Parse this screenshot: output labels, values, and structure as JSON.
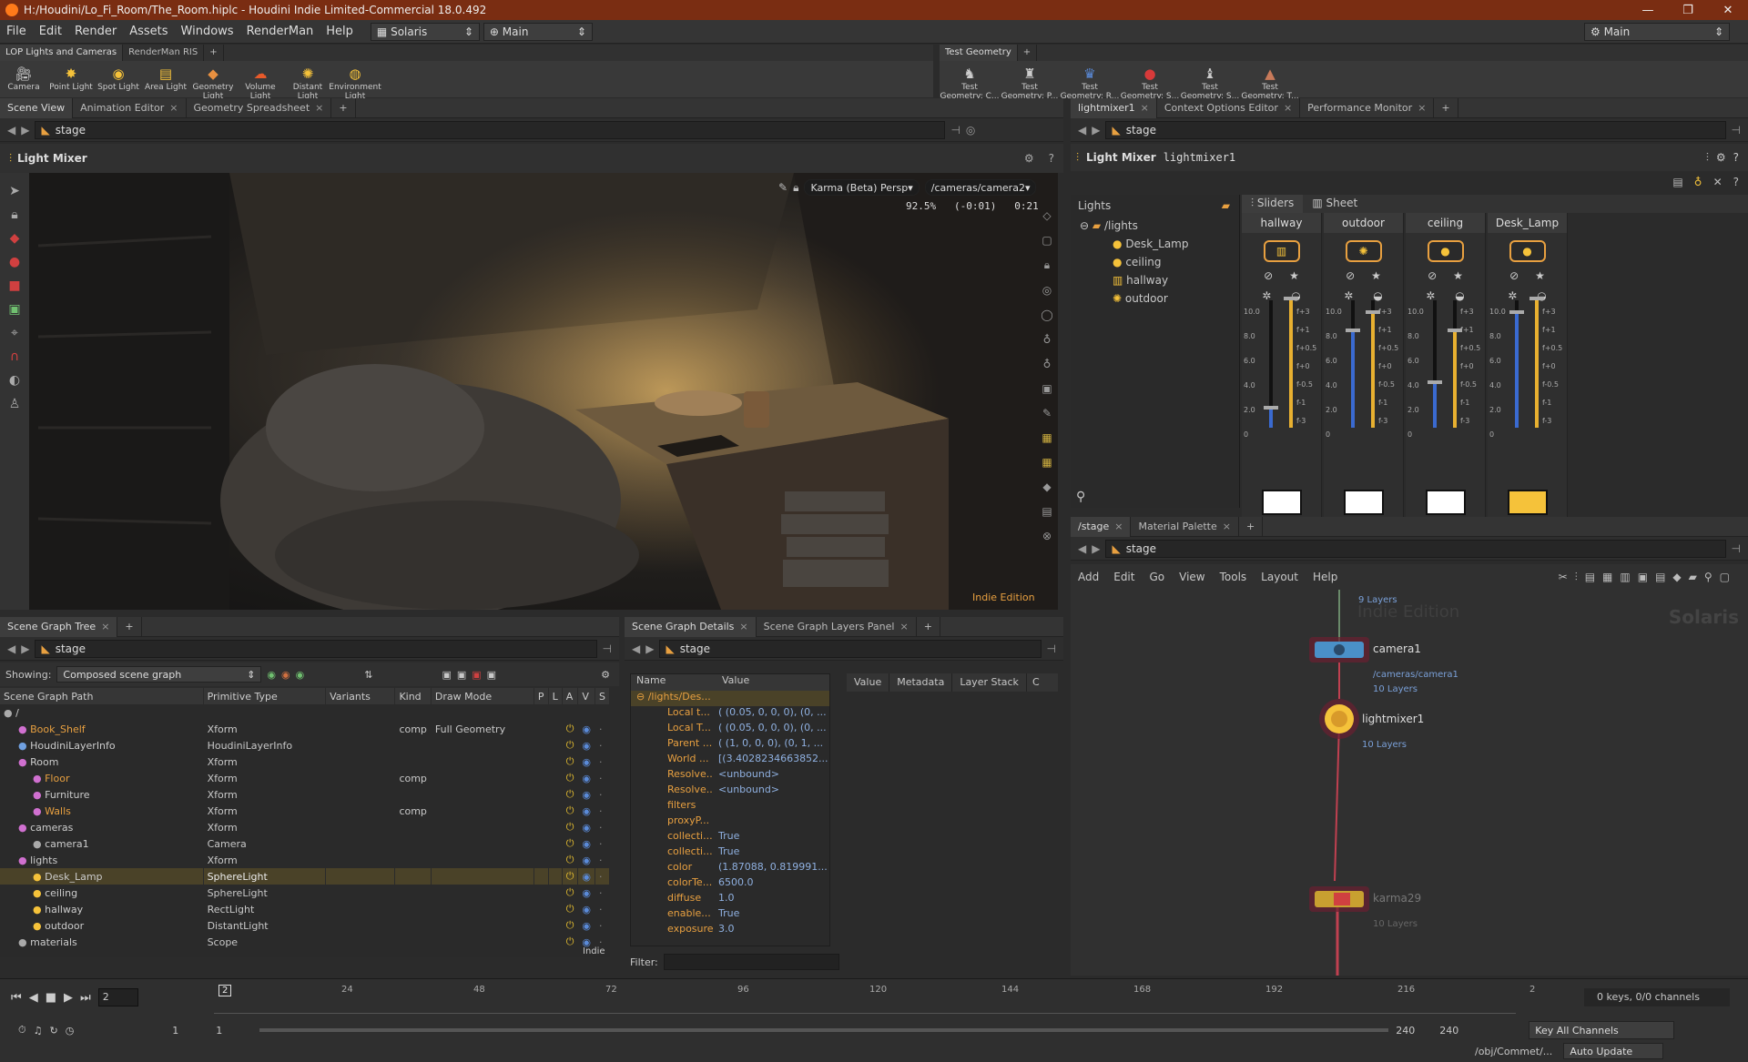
{
  "window": {
    "title": "H:/Houdini/Lo_Fi_Room/The_Room.hiplc - Houdini Indie Limited-Commercial 18.0.492",
    "controls": [
      "—",
      "❐",
      "✕"
    ]
  },
  "menu": {
    "items": [
      "File",
      "Edit",
      "Render",
      "Assets",
      "Windows",
      "RenderMan",
      "Help"
    ],
    "desktop": "Solaris",
    "context": "Main",
    "right_desktop": "Main"
  },
  "shelf_left": {
    "tabs": [
      "LOP Lights and Cameras",
      "RenderMan RIS"
    ],
    "tools": [
      {
        "label": "Camera",
        "icon": "camera-icon"
      },
      {
        "label": "Point Light",
        "icon": "point-light-icon"
      },
      {
        "label": "Spot Light",
        "icon": "spot-light-icon"
      },
      {
        "label": "Area Light",
        "icon": "area-light-icon"
      },
      {
        "label": "Geometry Light",
        "icon": "geometry-light-icon"
      },
      {
        "label": "Volume Light",
        "icon": "volume-light-icon"
      },
      {
        "label": "Distant Light",
        "icon": "distant-light-icon"
      },
      {
        "label": "Environment Light",
        "icon": "environment-light-icon"
      }
    ]
  },
  "shelf_right": {
    "tabs": [
      "Test Geometry"
    ],
    "tools": [
      "Test Geometry: C...",
      "Test Geometry: P...",
      "Test Geometry: R...",
      "Test Geometry: S...",
      "Test Geometry: S...",
      "Test Geometry: T..."
    ]
  },
  "scene_view": {
    "tabs": [
      "Scene View",
      "Animation Editor",
      "Geometry Spreadsheet"
    ],
    "path": "stage",
    "title": "Light Mixer",
    "renderer": "Karma (Beta)",
    "persp": "Persp",
    "camera": "/cameras/camera2",
    "stats": "92.5%   (-0:01)   0:21",
    "watermark": "Indie Edition"
  },
  "light_mixer": {
    "tabs": [
      "lightmixer1",
      "Context Options Editor",
      "Performance Monitor"
    ],
    "path": "stage",
    "title": "Light Mixer",
    "node": "lightmixer1",
    "lights_header": "Lights",
    "tree_root": "/lights",
    "tree": [
      "Desk_Lamp",
      "ceiling",
      "hallway",
      "outdoor"
    ],
    "view_tabs": [
      "Sliders",
      "Sheet"
    ],
    "strips": [
      {
        "name": "hallway",
        "swatch": "#ffffff"
      },
      {
        "name": "outdoor",
        "swatch": "#ffffff"
      },
      {
        "name": "ceiling",
        "swatch": "#ffffff"
      },
      {
        "name": "Desk_Lamp",
        "swatch": "#f5c23a"
      }
    ],
    "scale_left": [
      "10.0",
      "8.0",
      "6.0",
      "4.0",
      "2.0",
      "0"
    ],
    "scale_right": [
      "f+3",
      "f+1",
      "f+0.5",
      "f+0",
      "f-0.5",
      "f-1",
      "f-3"
    ]
  },
  "scene_graph": {
    "tabs": [
      "Scene Graph Tree"
    ],
    "path": "stage",
    "showing_label": "Showing:",
    "showing": "Composed scene graph",
    "columns": [
      "Scene Graph Path",
      "Primitive Type",
      "Variants",
      "Kind",
      "Draw Mode",
      "P",
      "L",
      "A",
      "V",
      "S"
    ],
    "rows": [
      {
        "name": "/",
        "type": "",
        "kind": "",
        "draw": "",
        "indent": 0
      },
      {
        "name": "Book_Shelf",
        "type": "Xform",
        "kind": "comp",
        "draw": "Full Geometry",
        "indent": 1
      },
      {
        "name": "HoudiniLayerInfo",
        "type": "HoudiniLayerInfo",
        "kind": "",
        "draw": "",
        "indent": 1
      },
      {
        "name": "Room",
        "type": "Xform",
        "kind": "",
        "draw": "",
        "indent": 1
      },
      {
        "name": "Floor",
        "type": "Xform",
        "kind": "comp",
        "draw": "",
        "indent": 2
      },
      {
        "name": "Furniture",
        "type": "Xform",
        "kind": "",
        "draw": "",
        "indent": 2
      },
      {
        "name": "Walls",
        "type": "Xform",
        "kind": "comp",
        "draw": "",
        "indent": 2
      },
      {
        "name": "cameras",
        "type": "Xform",
        "kind": "",
        "draw": "",
        "indent": 1
      },
      {
        "name": "camera1",
        "type": "Camera",
        "kind": "",
        "draw": "",
        "indent": 2
      },
      {
        "name": "lights",
        "type": "Xform",
        "kind": "",
        "draw": "",
        "indent": 1
      },
      {
        "name": "Desk_Lamp",
        "type": "SphereLight",
        "kind": "",
        "draw": "",
        "indent": 2
      },
      {
        "name": "ceiling",
        "type": "SphereLight",
        "kind": "",
        "draw": "",
        "indent": 2
      },
      {
        "name": "hallway",
        "type": "RectLight",
        "kind": "",
        "draw": "",
        "indent": 2
      },
      {
        "name": "outdoor",
        "type": "DistantLight",
        "kind": "",
        "draw": "",
        "indent": 2
      },
      {
        "name": "materials",
        "type": "Scope",
        "kind": "",
        "draw": "",
        "indent": 1
      }
    ],
    "watermark": "Indie"
  },
  "details": {
    "tabs": [
      "Scene Graph Details",
      "Scene Graph Layers Panel"
    ],
    "path": "stage",
    "col_name": "Name",
    "col_value": "Value",
    "root": "/lights/Des...",
    "rows": [
      {
        "n": "Local t...",
        "v": "( (0.05, 0, 0, 0), (0, ..."
      },
      {
        "n": "Local T...",
        "v": "( (0.05, 0, 0, 0), (0, ..."
      },
      {
        "n": "Parent ...",
        "v": "( (1, 0, 0, 0), (0, 1, ..."
      },
      {
        "n": "World ...",
        "v": "[(3.4028234663852..."
      },
      {
        "n": "Resolve...",
        "v": "<unbound>"
      },
      {
        "n": "Resolve...",
        "v": "<unbound>"
      },
      {
        "n": "filters",
        "v": ""
      },
      {
        "n": "proxyP...",
        "v": ""
      },
      {
        "n": "collecti...",
        "v": "True"
      },
      {
        "n": "collecti...",
        "v": "True"
      },
      {
        "n": "color",
        "v": "(1.87088, 0.819991..."
      },
      {
        "n": "colorTe...",
        "v": "6500.0"
      },
      {
        "n": "diffuse",
        "v": "1.0"
      },
      {
        "n": "enable...",
        "v": "True"
      },
      {
        "n": "exposure",
        "v": "3.0"
      }
    ],
    "value_tabs": [
      "Value",
      "Metadata",
      "Layer Stack",
      "C"
    ],
    "filter_label": "Filter:"
  },
  "network": {
    "tabs": [
      "/stage",
      "Material Palette"
    ],
    "path": "stage",
    "menu": [
      "Add",
      "Edit",
      "Go",
      "View",
      "Tools",
      "Layout",
      "Help"
    ],
    "watermark": "Indie Edition",
    "context": "Solaris",
    "nodes": [
      {
        "name": "",
        "sub": "",
        "layers": "9 Layers"
      },
      {
        "name": "camera1",
        "sub": "/cameras/camera1",
        "layers": "10 Layers"
      },
      {
        "name": "lightmixer1",
        "sub": "",
        "layers": "10 Layers"
      },
      {
        "name": "karma29",
        "sub": "",
        "layers": "10 Layers"
      }
    ]
  },
  "timeline": {
    "frame": "2",
    "marker": "2",
    "ticks": [
      "24",
      "48",
      "72",
      "96",
      "120",
      "144",
      "168",
      "192",
      "216",
      "2"
    ],
    "start": "1",
    "start2": "1",
    "end": "240",
    "end2": "240",
    "keys": "0 keys, 0/0 channels",
    "key_mode": "Key All Channels",
    "path": "/obj/Commet/...",
    "update": "Auto Update"
  }
}
